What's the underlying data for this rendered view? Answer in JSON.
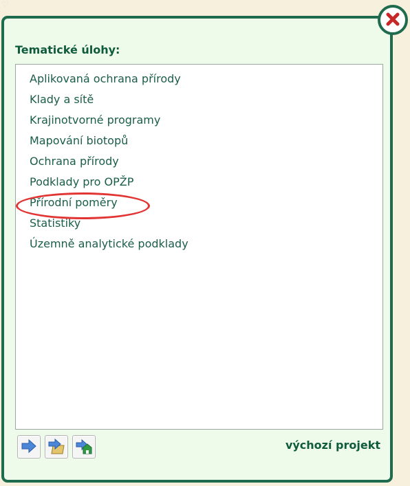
{
  "panel": {
    "title": "Tematické úlohy:",
    "items": [
      "Aplikovaná ochrana přírody",
      "Klady a sítě",
      "Krajinotvorné programy",
      "Mapování biotopů",
      "Ochrana přírody",
      "Podklady pro OPŽP",
      "Přírodní poměry",
      "Statistiky",
      "Územně analytické podklady"
    ],
    "highlighted_item": "Přírodní poměry"
  },
  "toolbar": {
    "buttons": [
      {
        "icon": "arrow-right-icon"
      },
      {
        "icon": "open-folder-arrow-icon"
      },
      {
        "icon": "home-arrow-icon"
      }
    ],
    "default_project_label": "výchozí projekt"
  },
  "close_button": {
    "icon": "close-icon"
  },
  "colors": {
    "panel_border": "#1f6b4e",
    "panel_background": "#eefbea",
    "title_text": "#0f5b3b",
    "list_text": "#1a5d49",
    "highlight": "#e33434",
    "arrow_blue": "#4b86d7",
    "home_green": "#2f9a41",
    "folder_yellow": "#e2c56c"
  }
}
